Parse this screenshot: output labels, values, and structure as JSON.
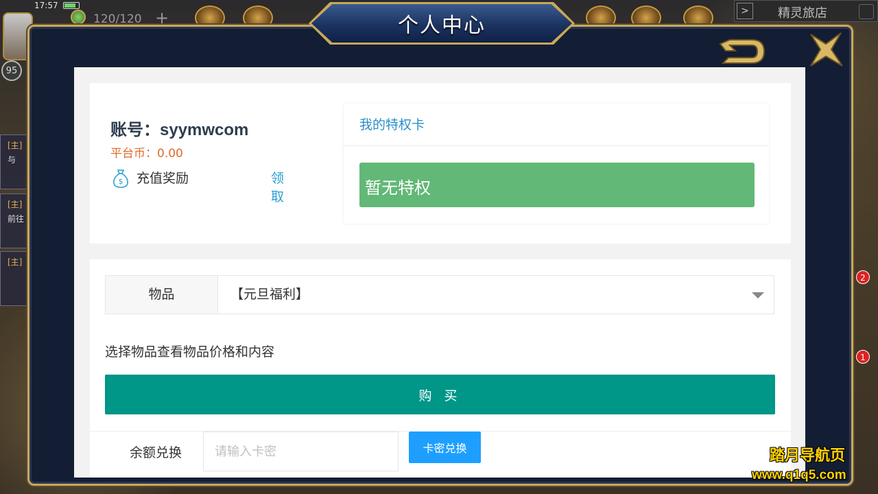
{
  "status_bar": {
    "time": "17:57"
  },
  "hud": {
    "energy": "120/120",
    "level": "95"
  },
  "shop": {
    "label": "精灵旅店"
  },
  "side_tasks": [
    {
      "tag": "[主]",
      "text": "与"
    },
    {
      "tag": "[主]",
      "text": "前往"
    },
    {
      "tag": "[主]",
      "text": ""
    }
  ],
  "badges": [
    "2",
    "1"
  ],
  "modal": {
    "title": "个人中心"
  },
  "account": {
    "label": "账号：",
    "username": "syymwcom",
    "coin_label": "平台币：",
    "coin_value": "0.00",
    "reward_label": "充值奖励",
    "claim_label": "领 取"
  },
  "privilege": {
    "header": "我的特权卡",
    "status": "暂无特权"
  },
  "shop_form": {
    "item_label": "物品",
    "item_value": "【元旦福利】",
    "hint": "选择物品查看物品价格和内容",
    "buy_label": "购 买"
  },
  "redeem": {
    "label": "余额兑换",
    "placeholder": "请输入卡密",
    "button_label": "卡密兑换"
  },
  "watermark": {
    "line1": "踏月导航页",
    "line2": "www.q1q5.com"
  },
  "colors": {
    "accent_teal": "#009688",
    "privilege_green": "#62b877",
    "link_blue": "#2aa0d4",
    "coin_orange": "#e06b2c",
    "redeem_blue": "#1e9fff",
    "frame_navy": "#131d33",
    "frame_gold": "#c8a85e"
  }
}
